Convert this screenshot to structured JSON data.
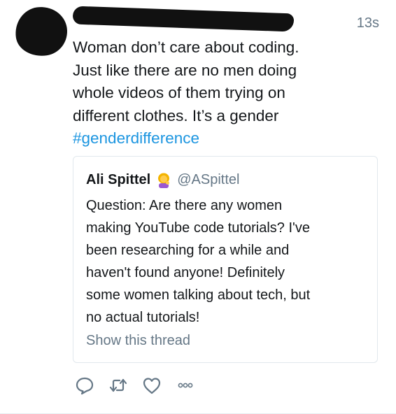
{
  "tweet": {
    "timestamp": "13s",
    "text_lines": [
      "Woman don’t care about coding.",
      "Just like there are no men doing",
      "whole videos of them trying on",
      "different clothes. It’s a gender"
    ],
    "hashtag": "#genderdifference"
  },
  "quote": {
    "name": "Ali Spittel",
    "handle": "@ASpittel",
    "emoji_icon": "woman-tipping-hand-icon",
    "text_lines": [
      "Question: Are there any women",
      "making YouTube code tutorials? I've",
      "been researching for a while and",
      "haven't found anyone! Definitely",
      "some women talking about tech, but",
      "no actual tutorials!"
    ],
    "show_thread": "Show this thread"
  },
  "actions": [
    {
      "name": "reply-icon"
    },
    {
      "name": "retweet-icon"
    },
    {
      "name": "like-icon"
    },
    {
      "name": "more-icon"
    }
  ],
  "colors": {
    "text": "#14171a",
    "secondary": "#657786",
    "hashtag": "#1b95e0",
    "border": "#e1e8ed"
  }
}
